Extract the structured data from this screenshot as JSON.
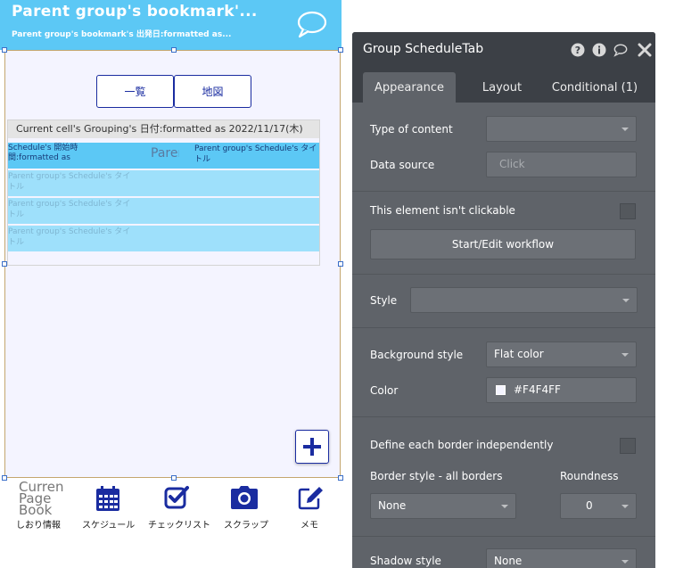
{
  "app": {
    "title": "Parent group's bookmark'...",
    "subtitle": "Parent group's bookmark's 出発日:formatted as...",
    "chat_icon": "chat-bubble-icon"
  },
  "buttons": {
    "list_label": "一覧",
    "map_label": "地図"
  },
  "repeating_group": {
    "header": "Current cell's Grouping's 日付:formatted as 2022/11/17(木)",
    "main_row": {
      "start_time": "Schedule's 開始時間:formatted as",
      "parent_label": "Parent",
      "title": "Parent group's Schedule's タイトル"
    },
    "faded_rows": [
      "Parent group's Schedule's タイトル",
      "Parent group's Schedule's タイトル",
      "Parent group's Schedule's タイトル"
    ]
  },
  "plus_icon": "plus-icon",
  "tab_bar": {
    "page_placeholder": "Current Page Book",
    "items": [
      {
        "label": "しおり情報",
        "icon": "bookmark-page-icon"
      },
      {
        "label": "スケジュール",
        "icon": "calendar-icon"
      },
      {
        "label": "チェックリスト",
        "icon": "checkbox-icon"
      },
      {
        "label": "スクラップ",
        "icon": "camera-icon"
      },
      {
        "label": "メモ",
        "icon": "edit-icon"
      }
    ]
  },
  "panel": {
    "title": "Group ScheduleTab",
    "tabs": [
      "Appearance",
      "Layout",
      "Conditional (1)"
    ],
    "type_of_content_label": "Type of content",
    "type_of_content_value": "",
    "data_source_label": "Data source",
    "data_source_value": "Click",
    "not_clickable_label": "This element isn't clickable",
    "workflow_button": "Start/Edit workflow",
    "style_label": "Style",
    "style_value": "",
    "background_style_label": "Background style",
    "background_style_value": "Flat color",
    "color_label": "Color",
    "color_value": "#F4F4FF",
    "border_independent_label": "Define each border independently",
    "border_style_label": "Border style - all borders",
    "border_style_value": "None",
    "roundness_label": "Roundness",
    "roundness_value": "0",
    "shadow_style_label": "Shadow style",
    "shadow_style_value": "None"
  },
  "colors": {
    "header": "#5cc8f5",
    "accent": "#1a2ca0",
    "canvas_bg": "#f4f4ff",
    "panel_bg": "#5f6369",
    "panel_head": "#3c4046"
  }
}
